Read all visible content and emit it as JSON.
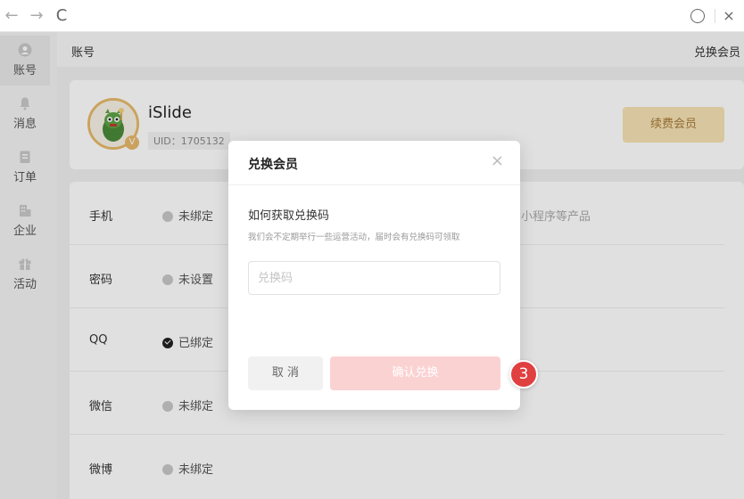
{
  "browser": {
    "back_glyph": "←",
    "forward_glyph": "→",
    "reload_glyph": "C",
    "compass_glyph": "⊘",
    "close_glyph": "×"
  },
  "sidebar": {
    "items": [
      {
        "label": "账号",
        "icon": "user-icon"
      },
      {
        "label": "消息",
        "icon": "bell-icon"
      },
      {
        "label": "订单",
        "icon": "order-icon"
      },
      {
        "label": "企业",
        "icon": "building-icon"
      },
      {
        "label": "活动",
        "icon": "gift-icon"
      }
    ]
  },
  "header": {
    "title": "账号",
    "redeem_link": "兑换会员"
  },
  "profile": {
    "username": "iSlide",
    "uid_text": "UID：1705132",
    "vip_badge": "V",
    "renew_label": "续费会员"
  },
  "bindings": [
    {
      "label": "手机",
      "status": "未绑定",
      "bound": false
    },
    {
      "label": "密码",
      "status": "未设置",
      "bound": false
    },
    {
      "label": "QQ",
      "status": "已绑定",
      "bound": true
    },
    {
      "label": "微信",
      "status": "未绑定",
      "bound": false
    },
    {
      "label": "微博",
      "status": "未绑定",
      "bound": false
    }
  ],
  "bindings_extra": "小程序等产品",
  "modal": {
    "title": "兑换会员",
    "close_glyph": "×",
    "heading": "如何获取兑换码",
    "description": "我们会不定期举行一些运营活动，届时会有兑换码可领取",
    "input_placeholder": "兑换码",
    "input_value": "",
    "cancel_label": "取 消",
    "confirm_label": "确认兑换"
  },
  "step_badge": "3",
  "colors": {
    "accent_red": "#e04040",
    "confirm_disabled": "#fbd2d2",
    "gold": "#e8b96a",
    "renew_bg": "#f6e3b4"
  }
}
